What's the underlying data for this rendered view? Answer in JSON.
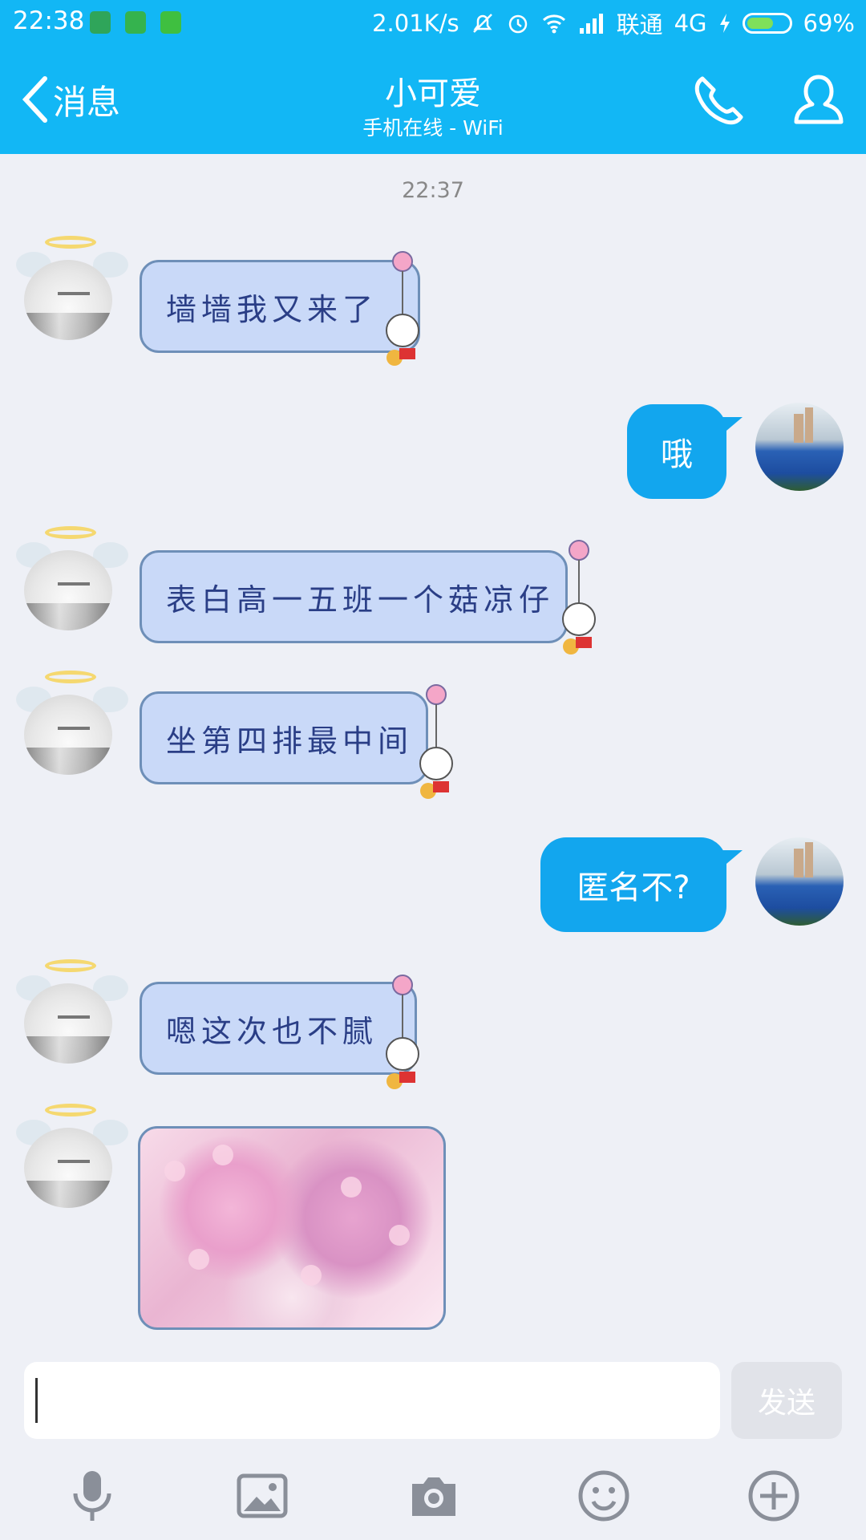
{
  "status_bar": {
    "time": "22:38",
    "speed": "2.01K/s",
    "carrier": "联通",
    "network": "4G",
    "battery_text": "69%",
    "battery_level": 0.69
  },
  "header": {
    "back_label": "消息",
    "title": "小可爱",
    "subtitle": "手机在线 - WiFi"
  },
  "chat": {
    "timestamp": "22:37",
    "messages": [
      {
        "side": "left",
        "text": "墙墙我又来了"
      },
      {
        "side": "right",
        "text": "哦"
      },
      {
        "side": "left",
        "text": "表白高一五班一个菇凉仔"
      },
      {
        "side": "left",
        "text": "坐第四排最中间"
      },
      {
        "side": "right",
        "text": "匿名不?"
      },
      {
        "side": "left",
        "text": "嗯这次也不腻"
      },
      {
        "side": "left",
        "type": "image"
      }
    ]
  },
  "input": {
    "value": "",
    "send_label": "发送"
  },
  "colors": {
    "header_bg": "#12b7f5",
    "right_bubble": "#12a6ee",
    "left_bubble": "#c9d9f8"
  }
}
